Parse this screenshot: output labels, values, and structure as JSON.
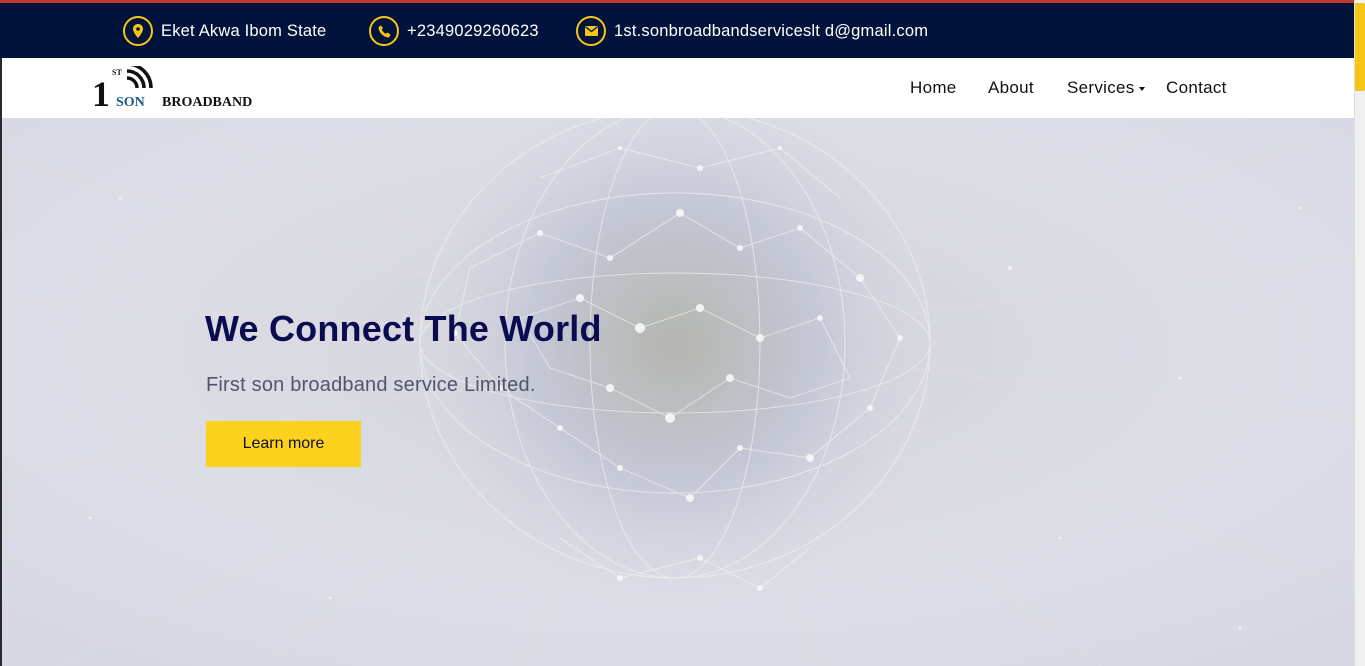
{
  "topbar": {
    "location": "Eket Akwa Ibom State",
    "phone": "+2349029260623",
    "email": "1st.sonbroadbandserviceslt d@gmail.com"
  },
  "brand": {
    "superscript": "ST",
    "number": "1",
    "son": "SON",
    "name": "BROADBAND"
  },
  "nav": {
    "home": "Home",
    "about": "About",
    "services": "Services",
    "contact": "Contact"
  },
  "hero": {
    "title": "We Connect The World",
    "subtitle": "First son broadband service Limited.",
    "cta": "Learn more"
  },
  "colors": {
    "topbar_bg": "#01133a",
    "accent_yellow": "#fdd21f",
    "title_navy": "#0b0c4f"
  },
  "icons": [
    "location-pin-icon",
    "phone-icon",
    "envelope-icon",
    "signal-waves-icon",
    "caret-down-icon"
  ]
}
